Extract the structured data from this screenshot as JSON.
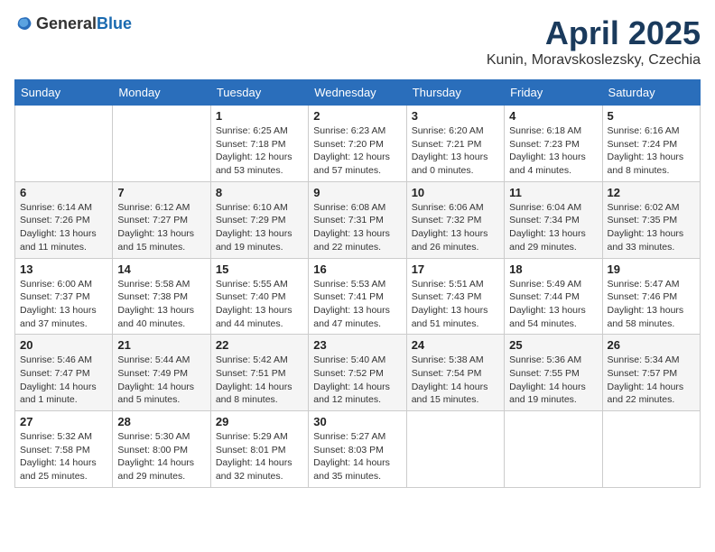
{
  "header": {
    "logo_general": "General",
    "logo_blue": "Blue",
    "month_year": "April 2025",
    "location": "Kunin, Moravskoslezsky, Czechia"
  },
  "days_of_week": [
    "Sunday",
    "Monday",
    "Tuesday",
    "Wednesday",
    "Thursday",
    "Friday",
    "Saturday"
  ],
  "weeks": [
    [
      {
        "day": "",
        "info": ""
      },
      {
        "day": "",
        "info": ""
      },
      {
        "day": "1",
        "info": "Sunrise: 6:25 AM\nSunset: 7:18 PM\nDaylight: 12 hours and 53 minutes."
      },
      {
        "day": "2",
        "info": "Sunrise: 6:23 AM\nSunset: 7:20 PM\nDaylight: 12 hours and 57 minutes."
      },
      {
        "day": "3",
        "info": "Sunrise: 6:20 AM\nSunset: 7:21 PM\nDaylight: 13 hours and 0 minutes."
      },
      {
        "day": "4",
        "info": "Sunrise: 6:18 AM\nSunset: 7:23 PM\nDaylight: 13 hours and 4 minutes."
      },
      {
        "day": "5",
        "info": "Sunrise: 6:16 AM\nSunset: 7:24 PM\nDaylight: 13 hours and 8 minutes."
      }
    ],
    [
      {
        "day": "6",
        "info": "Sunrise: 6:14 AM\nSunset: 7:26 PM\nDaylight: 13 hours and 11 minutes."
      },
      {
        "day": "7",
        "info": "Sunrise: 6:12 AM\nSunset: 7:27 PM\nDaylight: 13 hours and 15 minutes."
      },
      {
        "day": "8",
        "info": "Sunrise: 6:10 AM\nSunset: 7:29 PM\nDaylight: 13 hours and 19 minutes."
      },
      {
        "day": "9",
        "info": "Sunrise: 6:08 AM\nSunset: 7:31 PM\nDaylight: 13 hours and 22 minutes."
      },
      {
        "day": "10",
        "info": "Sunrise: 6:06 AM\nSunset: 7:32 PM\nDaylight: 13 hours and 26 minutes."
      },
      {
        "day": "11",
        "info": "Sunrise: 6:04 AM\nSunset: 7:34 PM\nDaylight: 13 hours and 29 minutes."
      },
      {
        "day": "12",
        "info": "Sunrise: 6:02 AM\nSunset: 7:35 PM\nDaylight: 13 hours and 33 minutes."
      }
    ],
    [
      {
        "day": "13",
        "info": "Sunrise: 6:00 AM\nSunset: 7:37 PM\nDaylight: 13 hours and 37 minutes."
      },
      {
        "day": "14",
        "info": "Sunrise: 5:58 AM\nSunset: 7:38 PM\nDaylight: 13 hours and 40 minutes."
      },
      {
        "day": "15",
        "info": "Sunrise: 5:55 AM\nSunset: 7:40 PM\nDaylight: 13 hours and 44 minutes."
      },
      {
        "day": "16",
        "info": "Sunrise: 5:53 AM\nSunset: 7:41 PM\nDaylight: 13 hours and 47 minutes."
      },
      {
        "day": "17",
        "info": "Sunrise: 5:51 AM\nSunset: 7:43 PM\nDaylight: 13 hours and 51 minutes."
      },
      {
        "day": "18",
        "info": "Sunrise: 5:49 AM\nSunset: 7:44 PM\nDaylight: 13 hours and 54 minutes."
      },
      {
        "day": "19",
        "info": "Sunrise: 5:47 AM\nSunset: 7:46 PM\nDaylight: 13 hours and 58 minutes."
      }
    ],
    [
      {
        "day": "20",
        "info": "Sunrise: 5:46 AM\nSunset: 7:47 PM\nDaylight: 14 hours and 1 minute."
      },
      {
        "day": "21",
        "info": "Sunrise: 5:44 AM\nSunset: 7:49 PM\nDaylight: 14 hours and 5 minutes."
      },
      {
        "day": "22",
        "info": "Sunrise: 5:42 AM\nSunset: 7:51 PM\nDaylight: 14 hours and 8 minutes."
      },
      {
        "day": "23",
        "info": "Sunrise: 5:40 AM\nSunset: 7:52 PM\nDaylight: 14 hours and 12 minutes."
      },
      {
        "day": "24",
        "info": "Sunrise: 5:38 AM\nSunset: 7:54 PM\nDaylight: 14 hours and 15 minutes."
      },
      {
        "day": "25",
        "info": "Sunrise: 5:36 AM\nSunset: 7:55 PM\nDaylight: 14 hours and 19 minutes."
      },
      {
        "day": "26",
        "info": "Sunrise: 5:34 AM\nSunset: 7:57 PM\nDaylight: 14 hours and 22 minutes."
      }
    ],
    [
      {
        "day": "27",
        "info": "Sunrise: 5:32 AM\nSunset: 7:58 PM\nDaylight: 14 hours and 25 minutes."
      },
      {
        "day": "28",
        "info": "Sunrise: 5:30 AM\nSunset: 8:00 PM\nDaylight: 14 hours and 29 minutes."
      },
      {
        "day": "29",
        "info": "Sunrise: 5:29 AM\nSunset: 8:01 PM\nDaylight: 14 hours and 32 minutes."
      },
      {
        "day": "30",
        "info": "Sunrise: 5:27 AM\nSunset: 8:03 PM\nDaylight: 14 hours and 35 minutes."
      },
      {
        "day": "",
        "info": ""
      },
      {
        "day": "",
        "info": ""
      },
      {
        "day": "",
        "info": ""
      }
    ]
  ]
}
